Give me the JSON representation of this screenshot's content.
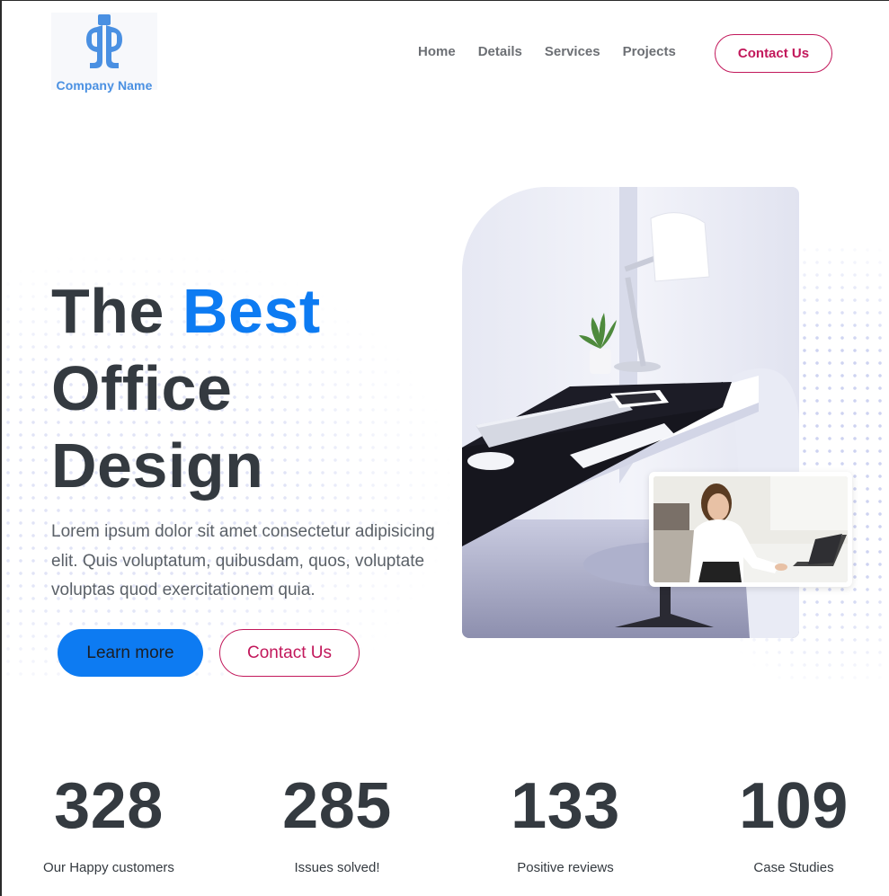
{
  "brand": {
    "name": "Company Name",
    "logo_icon": "company-logo-icon",
    "logo_color": "#4a90e2"
  },
  "nav": {
    "items": [
      {
        "label": "Home"
      },
      {
        "label": "Details"
      },
      {
        "label": "Services"
      },
      {
        "label": "Projects"
      }
    ],
    "cta_label": "Contact Us"
  },
  "hero": {
    "title_part1": "The ",
    "title_accent": "Best",
    "title_line2": "Office",
    "title_line3": "Design",
    "description": "Lorem ipsum dolor sit amet consectetur adipisicing elit. Quis voluptatum, quibusdam, quos, voluptate voluptas quod exercitationem quia.",
    "primary_button": "Learn more",
    "secondary_button": "Contact Us",
    "accent_color": "#0d7bf2",
    "secondary_color": "#c2185b"
  },
  "stats": [
    {
      "value": "328",
      "label": "Our Happy customers"
    },
    {
      "value": "285",
      "label": "Issues solved!"
    },
    {
      "value": "133",
      "label": "Positive reviews"
    },
    {
      "value": "109",
      "label": "Case Studies"
    }
  ]
}
